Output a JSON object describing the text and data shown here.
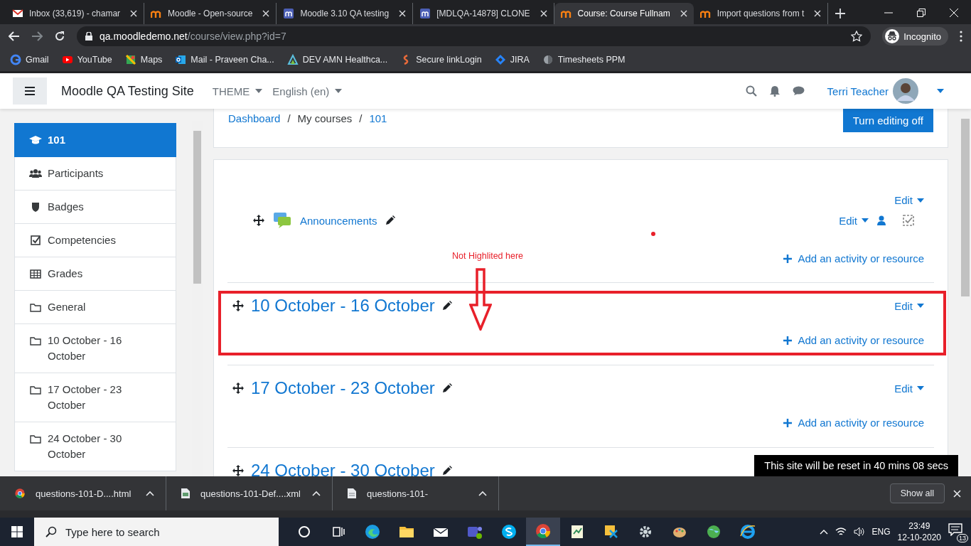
{
  "browser": {
    "tabs": [
      {
        "title": "Inbox (33,619) - chamar",
        "selected": false
      },
      {
        "title": "Moodle - Open-source",
        "selected": false
      },
      {
        "title": "Moodle 3.10 QA testing",
        "selected": false
      },
      {
        "title": "[MDLQA-14878] CLONE",
        "selected": false
      },
      {
        "title": "Course: Course Fullnam",
        "selected": true
      },
      {
        "title": "Import questions from t",
        "selected": false
      }
    ],
    "address": {
      "domain": "qa.moodledemo.net",
      "path": "/course/view.php?id=7"
    },
    "profile": "Incognito",
    "bookmarks": [
      "Gmail",
      "YouTube",
      "Maps",
      "Mail - Praveen Cha...",
      "DEV AMN Healthca...",
      "Secure linkLogin",
      "JIRA",
      "Timesheets PPM"
    ]
  },
  "navbar": {
    "site_name": "Moodle QA Testing Site",
    "menus": [
      "THEME",
      "English (en)"
    ],
    "user_name": "Terri Teacher"
  },
  "sidebar": {
    "items": [
      {
        "label": "101",
        "selected": true
      },
      {
        "label": "Participants",
        "selected": false
      },
      {
        "label": "Badges",
        "selected": false
      },
      {
        "label": "Competencies",
        "selected": false
      },
      {
        "label": "Grades",
        "selected": false
      },
      {
        "label": "General",
        "selected": false
      },
      {
        "label": "10 October - 16 October",
        "selected": false
      },
      {
        "label": "17 October - 23 October",
        "selected": false
      },
      {
        "label": "24 October - 30 October",
        "selected": false
      }
    ]
  },
  "breadcrumb": {
    "separator": "/",
    "items": [
      {
        "label": "Dashboard",
        "link": true
      },
      {
        "label": "My courses",
        "link": false
      },
      {
        "label": "101",
        "link": true
      }
    ]
  },
  "edit_button": "Turn editing off",
  "sections": [
    {
      "edit": "Edit",
      "activities": [
        {
          "name": "Announcements",
          "edit": "Edit"
        }
      ],
      "add": "Add an activity or resource",
      "marked": false
    },
    {
      "title": "10 October - 16 October",
      "edit": "Edit",
      "add": "Add an activity or resource",
      "marked": true
    },
    {
      "title": "17 October - 23 October",
      "edit": "Edit",
      "add": "Add an activity or resource",
      "marked": false
    },
    {
      "title": "24 October - 30 October",
      "marked": false
    }
  ],
  "annotation": {
    "label": "Not Highlited here"
  },
  "toast": "This site will be reset in 40 mins 08 secs",
  "downloads": {
    "items": [
      "questions-101-D....html",
      "questions-101-Def....xml",
      "questions-101-"
    ],
    "show_all": "Show all"
  },
  "taskbar": {
    "search_placeholder": "Type here to search",
    "apps": [
      {
        "selected": false
      },
      {
        "selected": false
      },
      {
        "selected": false
      },
      {
        "selected": false
      },
      {
        "selected": false
      },
      {
        "selected": false
      },
      {
        "selected": false
      },
      {
        "selected": true
      },
      {
        "selected": false
      },
      {
        "selected": false
      },
      {
        "selected": false
      },
      {
        "selected": false
      },
      {
        "selected": false
      },
      {
        "selected": false
      }
    ],
    "language": "ENG",
    "time": "23:49",
    "date": "12-10-2020",
    "notifications": "13"
  }
}
